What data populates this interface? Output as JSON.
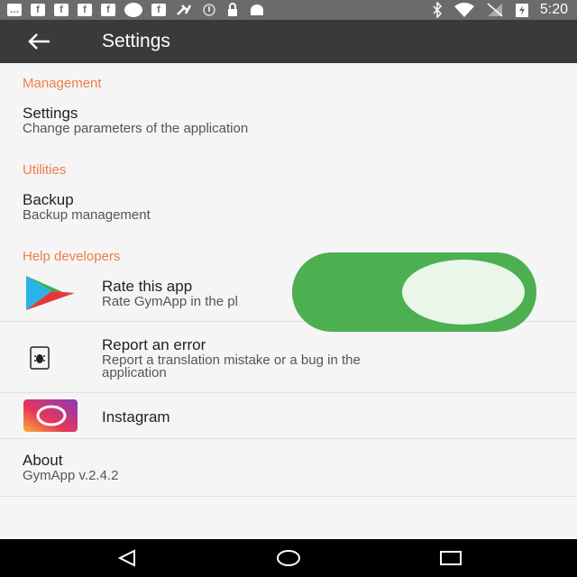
{
  "status_bar": {
    "time": "5:20",
    "left_icons": [
      "messages-icon",
      "facebook-icon",
      "facebook-icon",
      "facebook-icon",
      "facebook-icon",
      "circle-icon",
      "facebook-icon",
      "satellite-icon",
      "info-icon",
      "lock-icon",
      "android-icon"
    ],
    "right_icons": [
      "bluetooth-icon",
      "wifi-icon",
      "no-signal-icon",
      "battery-charging-icon"
    ]
  },
  "toolbar": {
    "title": "Settings"
  },
  "sections": {
    "management": {
      "title": "Management",
      "items": [
        {
          "title": "Settings",
          "subtitle": "Change parameters of the application"
        }
      ]
    },
    "utilities": {
      "title": "Utilities",
      "items": [
        {
          "title": "Backup",
          "subtitle": "Backup management"
        }
      ]
    },
    "help": {
      "title": "Help developers",
      "items": [
        {
          "title": "Rate this app",
          "subtitle": "Rate GymApp in the pl"
        },
        {
          "title": "Report an error",
          "subtitle_line1": "Report a translation mistake or a bug in the",
          "subtitle_line2": "application"
        },
        {
          "title": "Instagram"
        }
      ]
    },
    "about": {
      "title": "About",
      "subtitle": "GymApp v.2.4.2"
    }
  },
  "toggle": {
    "state": "on",
    "color": "#4caf50"
  },
  "colors": {
    "accent": "#f07d45",
    "toolbar": "#3a3a3a",
    "status_bar": "#6b6b6b"
  }
}
